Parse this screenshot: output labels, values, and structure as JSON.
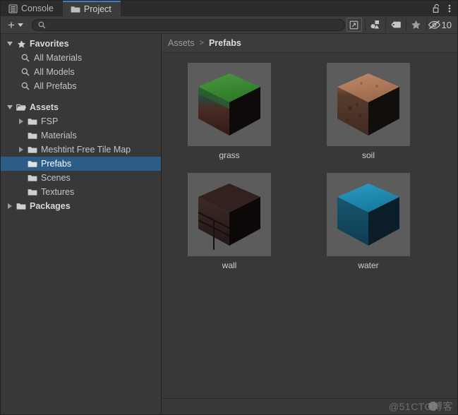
{
  "window": {
    "tabs": [
      {
        "label": "Console",
        "icon": "console-lines-icon",
        "active": false
      },
      {
        "label": "Project",
        "icon": "folder-icon",
        "active": true
      }
    ],
    "lock_icon": "unlocked-padlock-icon",
    "menu_icon": "kebab-menu-icon"
  },
  "toolbar": {
    "create_label": "+",
    "create_dropdown_icon": "chevron-down-icon",
    "search": {
      "value": "",
      "placeholder": "",
      "icon": "search-icon"
    },
    "save_search_icon": "save-search-icon",
    "type_filter_icon": "shapes-filter-icon",
    "label_filter_icon": "tag-icon",
    "favorite_filter_icon": "star-icon",
    "hidden_icon": "eye-crossed-icon",
    "hidden_count": "10"
  },
  "tree": {
    "nodes": [
      {
        "label": "Favorites",
        "icon": "star-icon",
        "twisty": "down",
        "depth": 1,
        "root": true,
        "selected": false
      },
      {
        "label": "All Materials",
        "icon": "search-icon",
        "twisty": "none",
        "depth": 2,
        "root": false,
        "selected": false
      },
      {
        "label": "All Models",
        "icon": "search-icon",
        "twisty": "none",
        "depth": 2,
        "root": false,
        "selected": false
      },
      {
        "label": "All Prefabs",
        "icon": "search-icon",
        "twisty": "none",
        "depth": 2,
        "root": false,
        "selected": false
      },
      {
        "label": "Assets",
        "icon": "folder-open-icon",
        "twisty": "down",
        "depth": 1,
        "root": true,
        "selected": false,
        "gap_before": true
      },
      {
        "label": "FSP",
        "icon": "folder-icon",
        "twisty": "right",
        "depth": 2,
        "root": false,
        "selected": false
      },
      {
        "label": "Materials",
        "icon": "folder-icon",
        "twisty": "none",
        "depth": 2,
        "root": false,
        "selected": false
      },
      {
        "label": "Meshtint Free Tile Map",
        "icon": "folder-icon",
        "twisty": "right",
        "depth": 2,
        "root": false,
        "selected": false
      },
      {
        "label": "Prefabs",
        "icon": "folder-icon",
        "twisty": "none",
        "depth": 2,
        "root": false,
        "selected": true
      },
      {
        "label": "Scenes",
        "icon": "folder-icon",
        "twisty": "none",
        "depth": 2,
        "root": false,
        "selected": false
      },
      {
        "label": "Textures",
        "icon": "folder-icon",
        "twisty": "none",
        "depth": 2,
        "root": false,
        "selected": false
      },
      {
        "label": "Packages",
        "icon": "folder-icon",
        "twisty": "right",
        "depth": 1,
        "root": true,
        "selected": false
      }
    ]
  },
  "breadcrumb": {
    "items": [
      "Assets",
      "Prefabs"
    ],
    "separator": ">"
  },
  "assets": [
    {
      "name": "grass",
      "kind": "cube-thumbnail",
      "top_color": "#3d8b33",
      "left_color": "#4a2f2a",
      "right_color": "#120d0c"
    },
    {
      "name": "soil",
      "kind": "cube-thumbnail",
      "top_color": "#b07a5b",
      "left_color": "#4e352c",
      "right_color": "#13100e"
    },
    {
      "name": "wall",
      "kind": "cube-thumbnail",
      "top_color": "#3a2a28",
      "left_color": "#2c1f1d",
      "right_color": "#0e0a0a"
    },
    {
      "name": "water",
      "kind": "cube-thumbnail",
      "top_color": "#1e8fb5",
      "left_color": "#14506b",
      "right_color": "#0a1c26"
    }
  ],
  "footer": {
    "watermark": "@51CTO博客"
  },
  "colors": {
    "selection_blue": "#2c5d87",
    "active_tab_accent": "#3d7cb8",
    "panel_bg": "#383838",
    "toolbar_bg": "#3c3c3c",
    "thumb_bg": "#5c5c5c"
  }
}
